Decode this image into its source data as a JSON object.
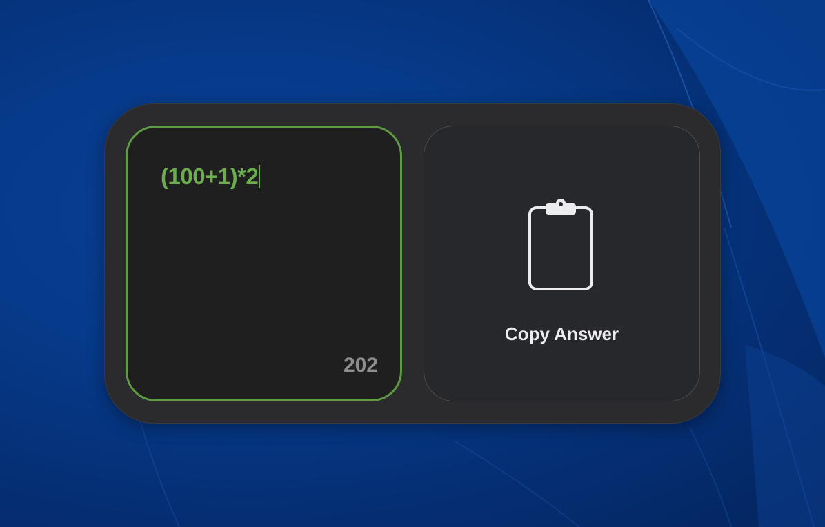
{
  "calculator": {
    "expression": "(100+1)*2",
    "answer": "202"
  },
  "copy_button": {
    "label": "Copy Answer",
    "icon": "clipboard-icon"
  },
  "colors": {
    "accent_green": "#6cae4d",
    "widget_bg": "#2b2b2d",
    "wallpaper_blue": "#063a8a"
  }
}
